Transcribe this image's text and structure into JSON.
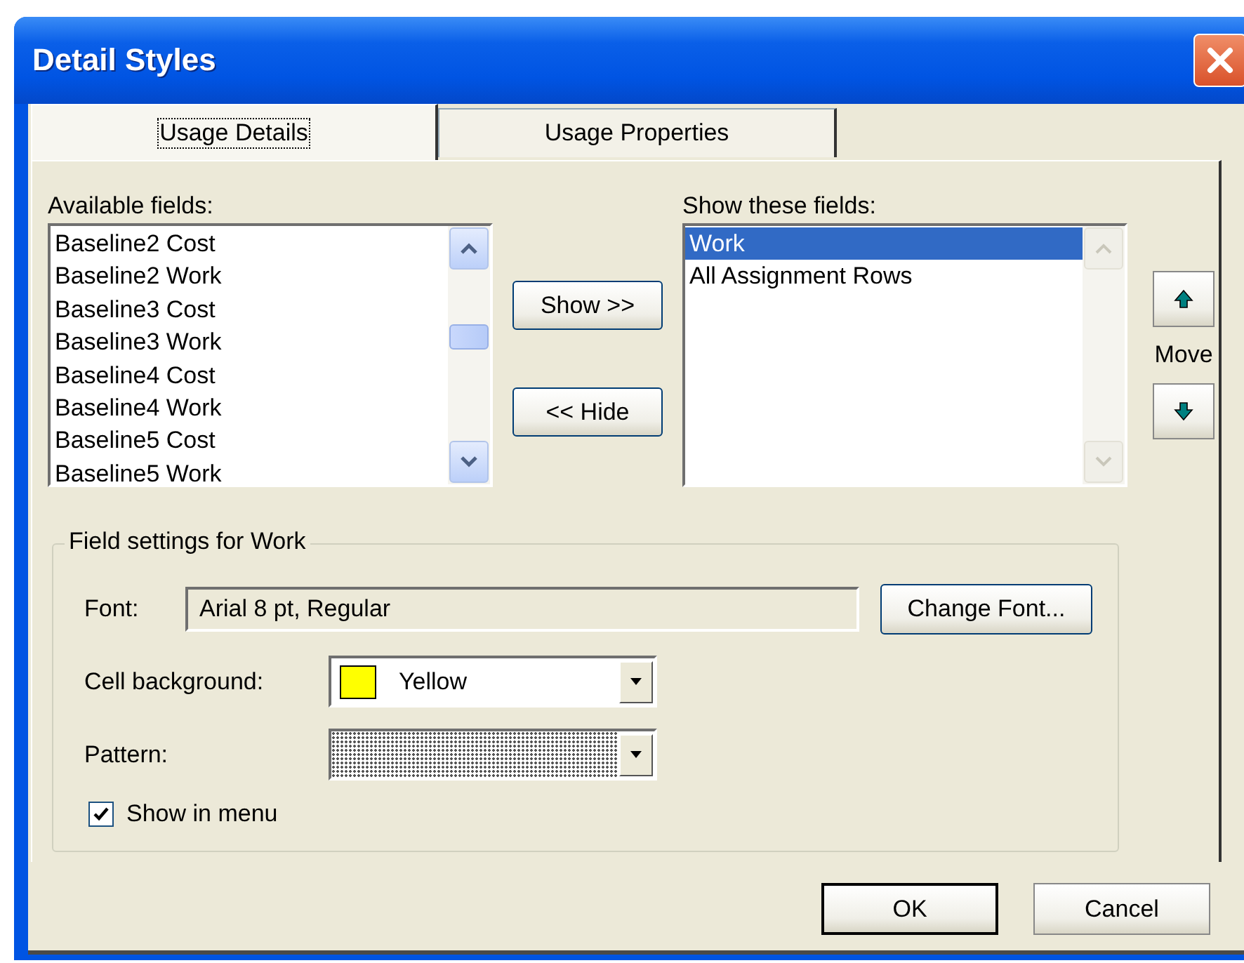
{
  "window": {
    "title": "Detail Styles"
  },
  "tabs": [
    {
      "label": "Usage Details",
      "selected": true
    },
    {
      "label": "Usage Properties",
      "selected": false
    }
  ],
  "available_fields": {
    "label": "Available fields:",
    "items": [
      {
        "label": "Baseline2 Cost",
        "selected": false
      },
      {
        "label": "Baseline2 Work",
        "selected": false
      },
      {
        "label": "Baseline3 Cost",
        "selected": false
      },
      {
        "label": "Baseline3 Work",
        "selected": false
      },
      {
        "label": "Baseline4 Cost",
        "selected": false
      },
      {
        "label": "Baseline4 Work",
        "selected": false
      },
      {
        "label": "Baseline5 Cost",
        "selected": false
      },
      {
        "label": "Baseline5 Work",
        "selected": false
      }
    ]
  },
  "show_button": "Show >>",
  "hide_button": "<< Hide",
  "shown_fields": {
    "label": "Show these fields:",
    "items": [
      {
        "label": "Work",
        "selected": true
      },
      {
        "label": "All Assignment Rows",
        "selected": false
      }
    ]
  },
  "move_label": "Move",
  "field_settings": {
    "title": "Field settings for Work",
    "font_label": "Font:",
    "font_value": "Arial 8 pt, Regular",
    "change_font_button": "Change Font...",
    "cell_background_label": "Cell background:",
    "cell_background": {
      "value": "Yellow",
      "color": "#ffff00"
    },
    "pattern_label": "Pattern:",
    "show_in_menu": {
      "label": "Show in menu",
      "checked": true
    }
  },
  "buttons": [
    {
      "label": "OK",
      "default": true
    },
    {
      "label": "Cancel",
      "default": false
    }
  ]
}
